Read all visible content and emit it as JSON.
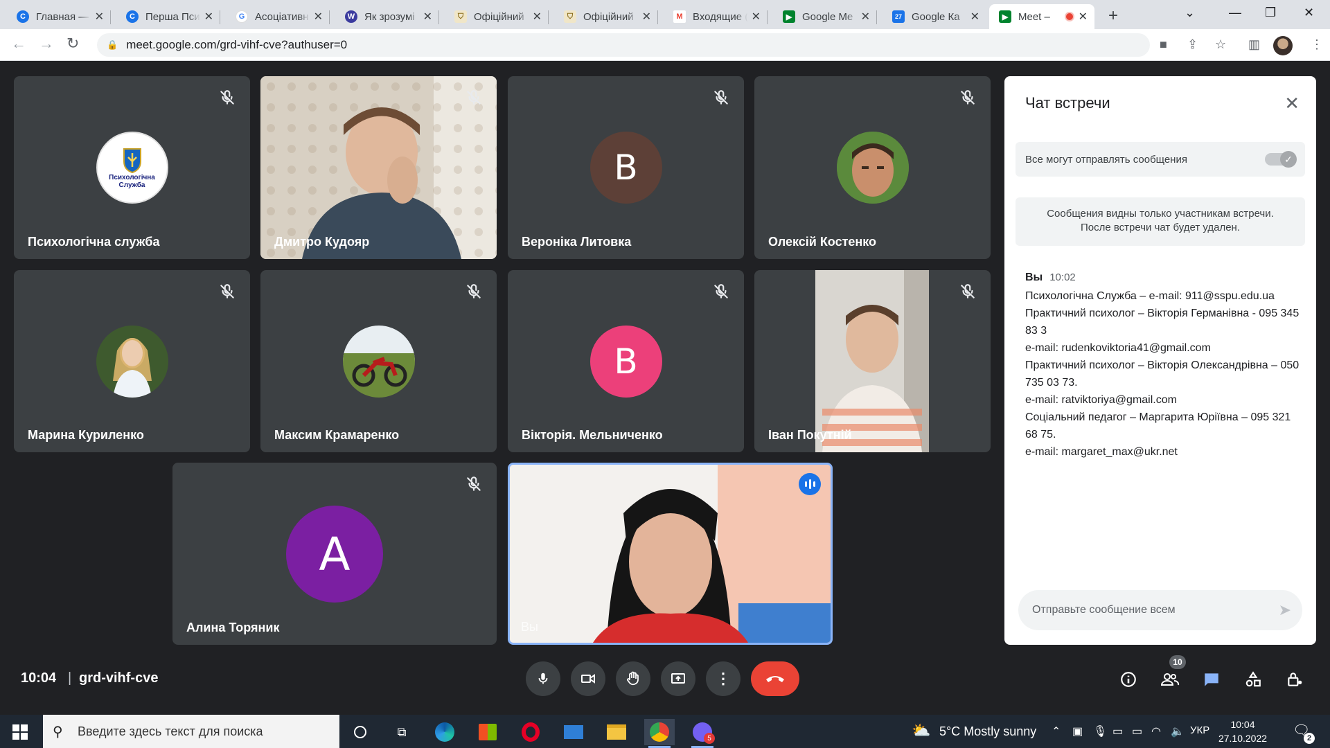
{
  "browser": {
    "tabs": [
      {
        "label": "Главная —",
        "icon": "copilot-icon",
        "color": "#1a73e8"
      },
      {
        "label": "Перша Пси",
        "icon": "copilot-icon",
        "color": "#1a73e8"
      },
      {
        "label": "Асоціативн",
        "icon": "google-icon",
        "color": "#4285f4"
      },
      {
        "label": "Як зрозумі",
        "icon": "w-icon",
        "color": "#3b3b9e"
      },
      {
        "label": "Офіційний",
        "icon": "crest-icon",
        "color": "#c9a227"
      },
      {
        "label": "Офіційний",
        "icon": "crest-icon",
        "color": "#c9a227"
      },
      {
        "label": "Входящие (",
        "icon": "gmail-icon",
        "color": "#ea4335"
      },
      {
        "label": "Google Me",
        "icon": "meet-icon",
        "color": "#00832d"
      },
      {
        "label": "Google Ка",
        "icon": "calendar-icon",
        "color": "#1a73e8"
      },
      {
        "label": "Meet –",
        "icon": "meet-icon",
        "color": "#00832d"
      }
    ],
    "url": "meet.google.com/grd-vihf-cve?authuser=0"
  },
  "participants": [
    {
      "name": "Психологічна служба",
      "avatar_text": "Психологічна Служба"
    },
    {
      "name": "Дмитро Кудояр"
    },
    {
      "name": "Вероніка Литовка",
      "avatar_letter": "В",
      "avatar_color": "#5d4037"
    },
    {
      "name": "Олексій Костенко"
    },
    {
      "name": "Марина Куриленко"
    },
    {
      "name": "Максим Крамаренко"
    },
    {
      "name": "Вікторія. Мельниченко",
      "avatar_letter": "В",
      "avatar_color": "#ec407a"
    },
    {
      "name": "Іван Покутній"
    },
    {
      "name": "Алина Торяник",
      "avatar_letter": "А",
      "avatar_color": "#7b1fa2"
    },
    {
      "name": "Вы"
    }
  ],
  "chat": {
    "title": "Чат встречи",
    "permission_label": "Все могут отправлять сообщения",
    "notice_line1": "Сообщения видны только участникам встречи.",
    "notice_line2": "После встречи чат будет удален.",
    "message": {
      "sender": "Вы",
      "time": "10:02",
      "lines": [
        "Психологічна Служба – e-mail: 911@sspu.edu.ua",
        "Практичний психолог – Вікторія Германівна - 095 345 83 3",
        "e-mail: rudenkoviktoria41@gmail.com",
        "Практичний психолог – Вікторія Олександрівна – 050 735 03 73.",
        "e-mail: ratviktoriya@gmail.com",
        "Соціальний педагог – Маргарита Юріївна – 095 321 68 75.",
        "e-mail: margaret_max@ukr.net"
      ]
    },
    "input_placeholder": "Отправьте сообщение всем"
  },
  "meeting": {
    "time": "10:04",
    "code": "grd-vihf-cve",
    "people_count": "10"
  },
  "taskbar": {
    "search_placeholder": "Введите здесь текст для поиска",
    "weather": "5°C  Mostly sunny",
    "language": "УКР",
    "time": "10:04",
    "date": "27.10.2022",
    "viber_badge": "5",
    "notifications_badge": "2"
  }
}
